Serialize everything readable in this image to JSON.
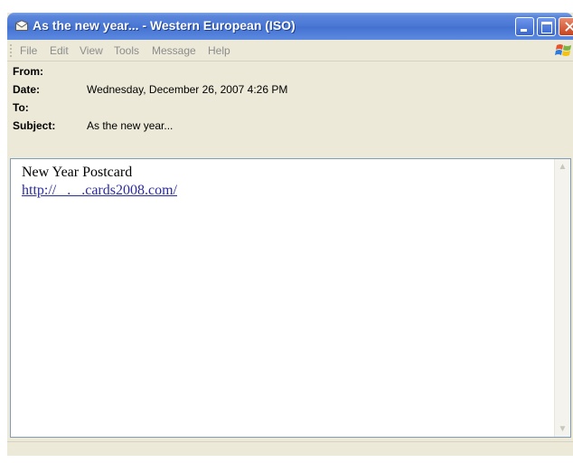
{
  "window": {
    "title": "As the new year... - Western European (ISO)"
  },
  "menu": [
    "File",
    "Edit",
    "View",
    "Tools",
    "Message",
    "Help"
  ],
  "headers": {
    "from_label": "From:",
    "from_value": "",
    "date_label": "Date:",
    "date_value": "Wednesday, December 26, 2007 4:26 PM",
    "to_label": "To:",
    "to_value": "",
    "subject_label": "Subject:",
    "subject_value": "As the new year..."
  },
  "body": {
    "line1": "New Year Postcard",
    "link": "http://   .   .cards2008.com/"
  },
  "colors": {
    "titlebar": "#4c79d6",
    "close_button": "#c8431f",
    "link": "#2b2ba0"
  }
}
